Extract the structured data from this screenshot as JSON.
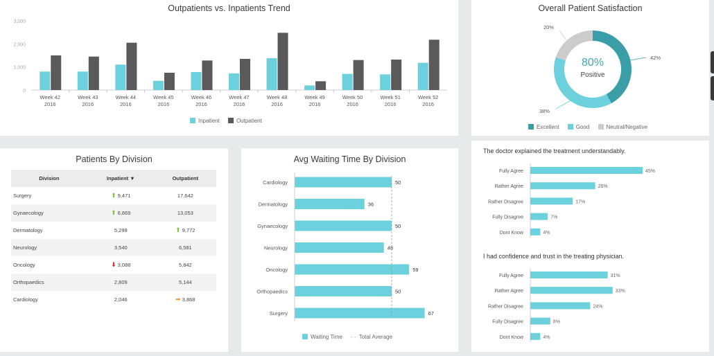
{
  "colors": {
    "inpatient": "#6dd0dd",
    "outpatient": "#5a5a5a",
    "excellent": "#3a9ea8",
    "good": "#6dd0dd",
    "neutral": "#cccccc",
    "waiting": "#6dd0dd",
    "pct_text": "#3aa8b8"
  },
  "trend": {
    "title": "Outpatients vs. Inpatients Trend",
    "yticks": [
      "3,000",
      "2,000",
      "1,000",
      "0"
    ],
    "xlabels": [
      [
        "Week 42",
        "2016"
      ],
      [
        "Week 43",
        "2016"
      ],
      [
        "Week 44",
        "2016"
      ],
      [
        "Week 45",
        "2016"
      ],
      [
        "Week 46",
        "2016"
      ],
      [
        "Week 47",
        "2016"
      ],
      [
        "Week 48",
        "2016"
      ],
      [
        "Week 49",
        "2016"
      ],
      [
        "Week 50",
        "2016"
      ],
      [
        "Week 51",
        "2016"
      ],
      [
        "Week 52",
        "2016"
      ]
    ],
    "legend": {
      "inpatient": "Inpatient",
      "outpatient": "Outpatient"
    }
  },
  "satisfaction": {
    "title": "Overall Patient Satisfaction",
    "center_value": "80%",
    "center_label": "Positive",
    "labels": {
      "excellent": "42%",
      "good": "38%",
      "neutral": "20%"
    },
    "legend": {
      "excellent": "Excellent",
      "good": "Good",
      "neutral": "Neutral/Negative"
    }
  },
  "division_table": {
    "title": "Patients By Division",
    "headers": [
      "Division",
      "Inpatient ▼",
      "Outpatient"
    ],
    "rows": [
      {
        "division": "Surgery",
        "inpatient": "9,471",
        "inpatient_trend": "up",
        "outpatient": "17,642",
        "outpatient_trend": ""
      },
      {
        "division": "Gynaecology",
        "inpatient": "6,869",
        "inpatient_trend": "up",
        "outpatient": "13,053",
        "outpatient_trend": ""
      },
      {
        "division": "Dermatology",
        "inpatient": "5,299",
        "inpatient_trend": "",
        "outpatient": "9,772",
        "outpatient_trend": "up"
      },
      {
        "division": "Neurology",
        "inpatient": "3,540",
        "inpatient_trend": "",
        "outpatient": "6,581",
        "outpatient_trend": ""
      },
      {
        "division": "Oncology",
        "inpatient": "3,088",
        "inpatient_trend": "down",
        "outpatient": "5,842",
        "outpatient_trend": ""
      },
      {
        "division": "Orthopaedics",
        "inpatient": "2,809",
        "inpatient_trend": "",
        "outpatient": "5,144",
        "outpatient_trend": ""
      },
      {
        "division": "Cardiology",
        "inpatient": "2,046",
        "inpatient_trend": "",
        "outpatient": "3,868",
        "outpatient_trend": "right"
      }
    ]
  },
  "waiting": {
    "title": "Avg Waiting Time By Division",
    "legend": {
      "waiting": "Waiting Time",
      "average": "Total Average"
    }
  },
  "q1": {
    "title": "The doctor explained the treatment understandably."
  },
  "q2": {
    "title": "I had confidence and trust in the treating physician."
  },
  "chart_data": [
    {
      "type": "bar",
      "title": "Outpatients vs. Inpatients Trend",
      "categories": [
        "Week 42 2016",
        "Week 43 2016",
        "Week 44 2016",
        "Week 45 2016",
        "Week 46 2016",
        "Week 47 2016",
        "Week 48 2016",
        "Week 49 2016",
        "Week 50 2016",
        "Week 51 2016",
        "Week 52 2016"
      ],
      "series": [
        {
          "name": "Inpatient",
          "values": [
            800,
            800,
            1100,
            400,
            780,
            720,
            1380,
            200,
            700,
            680,
            1180
          ]
        },
        {
          "name": "Outpatient",
          "values": [
            1500,
            1450,
            2050,
            750,
            1280,
            1350,
            2480,
            380,
            1300,
            1320,
            2180
          ]
        }
      ],
      "ylim": [
        0,
        3000
      ],
      "legend": "bottom"
    },
    {
      "type": "pie",
      "title": "Overall Patient Satisfaction",
      "categories": [
        "Excellent",
        "Good",
        "Neutral/Negative"
      ],
      "values": [
        42,
        38,
        20
      ],
      "legend": "bottom"
    },
    {
      "type": "bar",
      "title": "Avg Waiting Time By Division",
      "orientation": "horizontal",
      "categories": [
        "Cardiology",
        "Dermatology",
        "Gynaecology",
        "Neurology",
        "Oncology",
        "Orthopaedics",
        "Surgery"
      ],
      "series": [
        {
          "name": "Waiting Time",
          "values": [
            50,
            36,
            50,
            46,
            59,
            50,
            67
          ]
        }
      ],
      "total_average": 50,
      "xlim": [
        0,
        70
      ],
      "legend": "bottom"
    },
    {
      "type": "bar",
      "orientation": "horizontal",
      "title": "The doctor explained the treatment understandably.",
      "categories": [
        "Fully Agree",
        "Rather Agree",
        "Rather Disagree",
        "Fully Disagree",
        "Dont Know"
      ],
      "values": [
        45,
        26,
        17,
        7,
        4
      ],
      "value_labels": [
        "45%",
        "26%",
        "17%",
        "7%",
        "4%"
      ]
    },
    {
      "type": "bar",
      "orientation": "horizontal",
      "title": "I had confidence and trust in the treating physician.",
      "categories": [
        "Fully Agree",
        "Rather Agree",
        "Rather Disagree",
        "Fully Disagree",
        "Dont Know"
      ],
      "values": [
        31,
        33,
        24,
        8,
        4
      ],
      "value_labels": [
        "31%",
        "33%",
        "24%",
        "8%",
        "4%"
      ]
    }
  ]
}
